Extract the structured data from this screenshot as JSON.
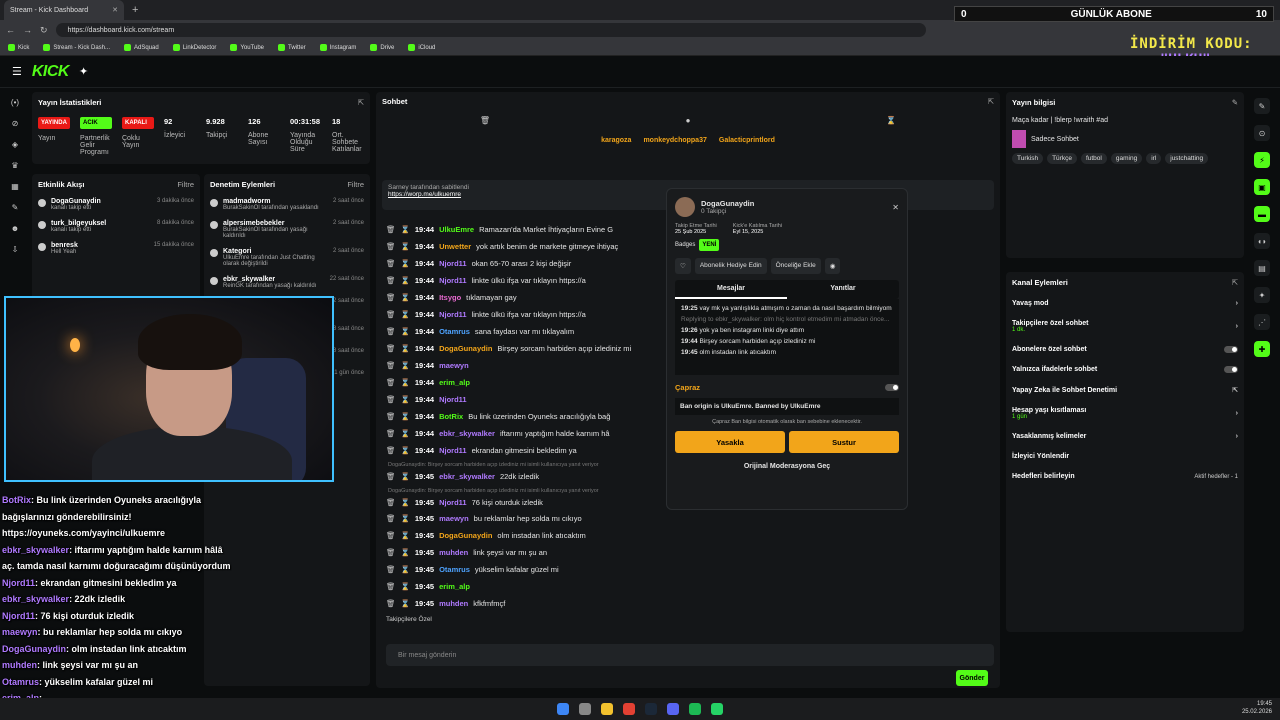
{
  "browser": {
    "tab_title": "Stream - Kick Dashboard",
    "url": "https://dashboard.kick.com/stream",
    "bookmarks": [
      "Kick",
      "Stream - Kick Dash...",
      "AdSquad",
      "LinkDetector",
      "YouTube",
      "Twitter",
      "Instagram",
      "Drive",
      "iCloud"
    ]
  },
  "overlay_top": {
    "count": "0",
    "label": "GÜNLÜK ABONE",
    "goal": "10",
    "promo1": "İNDİRİM KODU:",
    "promo2": "\"ULKU\""
  },
  "brand": {
    "logo": "KICK",
    "accent": "#53fc18"
  },
  "stats": {
    "title": "Yayın İstatistikleri",
    "items": [
      {
        "value": "YAYINDA",
        "label": "Yayın"
      },
      {
        "value": "ACIK",
        "label": "Partnerlik Gelir Programı"
      },
      {
        "value": "KAPALI",
        "label": "Çoklu Yayın"
      },
      {
        "value": "92",
        "label": "İzleyici"
      },
      {
        "value": "9.928",
        "label": "Takipçi"
      },
      {
        "value": "126",
        "label": "Abone Sayısı"
      },
      {
        "value": "00:31:58",
        "label": "Yayında Olduğu Süre"
      },
      {
        "value": "18",
        "label": "Ort. Sohbete Katılanlar"
      }
    ]
  },
  "activity": {
    "title": "Etkinlik Akışı",
    "filter": "Filtre",
    "items": [
      {
        "name": "DogaGunaydin",
        "sub": "kanalı takip etti",
        "time": "3 dakika önce"
      },
      {
        "name": "turk_bilgeyuksel",
        "sub": "kanalı takip etti",
        "time": "8 dakika önce"
      },
      {
        "name": "benresk",
        "sub": "Hell Yeah",
        "time": "15 dakika önce"
      }
    ]
  },
  "moderation": {
    "title": "Denetim Eylemleri",
    "filter": "Filtre",
    "items": [
      {
        "name": "madmadworm",
        "sub": "BurakSakinOl tarafından yasaklandı",
        "time": "2 saat önce"
      },
      {
        "name": "alpersimebebekler",
        "sub": "BurakSakinOl tarafından yasağı kaldırıldı",
        "time": "2 saat önce"
      },
      {
        "name": "Kategori",
        "sub": "UlkuEmre tarafından Just Chatting olarak değiştirildi",
        "time": "2 saat önce"
      },
      {
        "name": "ebkr_skywalker",
        "sub": "ReinGK tarafından yasağı kaldırıldı",
        "time": "22 saat önce"
      },
      {
        "name": "ebkr_skywalker",
        "sub": "ReinGK tarafından 5 dakika süreliğine sohbetten uzaklaştırıldı",
        "time": "22 saat önce"
      },
      {
        "name": "Mesaj Sabitlendi",
        "sub": "Sarney tarafından",
        "time": "18 saat önce"
      },
      {
        "name": "Mesaj Sabitlendi",
        "sub": "ReinGK tarafından",
        "time": "18 saat önce"
      },
      {
        "name": "PR_Yair",
        "sub": "MeyhaneciDimitri tarafından yasaklandı",
        "time": "1 gün önce"
      }
    ]
  },
  "chat": {
    "title": "Sohbet",
    "top_users": [
      {
        "name": "karagoza",
        "count": ""
      },
      {
        "name": "monkeydchoppa37",
        "count": "2"
      },
      {
        "name": "Galacticprintlord",
        "count": "1"
      }
    ],
    "pinned_by": "Sarney tarafından sabitlendi",
    "pinned_link": "https://worp.me/ulkuemre",
    "messages": [
      {
        "time": "19:44",
        "user": "UlkuEmre",
        "color": "#53fc18",
        "text": "Ramazan'da Market İhtiyaçların Evine G"
      },
      {
        "time": "19:44",
        "user": "Unwetter",
        "color": "#f2a51a",
        "text": "yok artık benim de markete gitmeye ihtiyaç"
      },
      {
        "time": "19:44",
        "user": "Njord11",
        "color": "#b07aff",
        "text": "okan 65-70 arası 2 kişi değişir"
      },
      {
        "time": "19:44",
        "user": "Njord11",
        "color": "#b07aff",
        "text": "linkte ülkü ifşa var tıklayın https://a"
      },
      {
        "time": "19:44",
        "user": "Itsygo",
        "color": "#e86ad1",
        "text": "tıklamayan gay"
      },
      {
        "time": "19:44",
        "user": "Njord11",
        "color": "#b07aff",
        "text": "linkte ülkü ifşa var tıklayın https://a"
      },
      {
        "time": "19:44",
        "user": "Otamrus",
        "color": "#4ea3ff",
        "text": "sana faydası var mı tıklayalım"
      },
      {
        "time": "19:44",
        "user": "DogaGunaydin",
        "color": "#f2a51a",
        "text": "Birşey sorcam harbiden açıp izlediniz mi"
      },
      {
        "time": "19:44",
        "user": "maewyn",
        "color": "#b07aff",
        "text": ""
      },
      {
        "time": "19:44",
        "user": "erim_alp",
        "color": "#53fc18",
        "text": ""
      },
      {
        "time": "19:44",
        "user": "Njord11",
        "color": "#b07aff",
        "text": ""
      },
      {
        "time": "19:44",
        "user": "BotRix",
        "color": "#53fc18",
        "text": "Bu link üzerinden Oyuneks aracılığıyla bağ"
      },
      {
        "time": "19:44",
        "user": "ebkr_skywalker",
        "color": "#b07aff",
        "text": "iftarımı yaptığım halde karnım hâ"
      },
      {
        "time": "19:44",
        "user": "Njord11",
        "color": "#b07aff",
        "text": "ekrandan gitmesini bekledim ya"
      },
      {
        "time": "19:45",
        "user": "ebkr_skywalker",
        "color": "#b07aff",
        "text": "22dk izledik"
      },
      {
        "time": "19:45",
        "user": "Njord11",
        "color": "#b07aff",
        "text": "76 kişi oturduk izledik"
      },
      {
        "time": "19:45",
        "user": "maewyn",
        "color": "#b07aff",
        "text": "bu reklamlar hep solda mı cıkıyo"
      },
      {
        "time": "19:45",
        "user": "DogaGunaydin",
        "color": "#f2a51a",
        "text": "olm instadan link atıcaktım"
      },
      {
        "time": "19:45",
        "user": "muhden",
        "color": "#b07aff",
        "text": "link şeysi var mı şu an"
      },
      {
        "time": "19:45",
        "user": "Otamrus",
        "color": "#4ea3ff",
        "text": "yükselim kafalar güzel mi"
      },
      {
        "time": "19:45",
        "user": "erim_alp",
        "color": "#53fc18",
        "text": ""
      },
      {
        "time": "19:45",
        "user": "muhden",
        "color": "#b07aff",
        "text": "kfkfmfmçf"
      }
    ],
    "reply1": "DogaGunaydin: Birşey sorcam harbiden açıp izlediniz mi isimli kullanıcıya yanıt veriyor",
    "reply2": "DogaGunaydin: Birşey sorcam harbiden açıp izlediniz mi isimli kullanıcıya yanıt veriyor",
    "followers_only": "Takipçilere Özel",
    "input_placeholder": "Bir mesaj gönderin",
    "send": "Gönder"
  },
  "usercard": {
    "name": "DogaGunaydin",
    "followers": "0 Takipçi",
    "follow_date_label": "Takip Etme Tarihi",
    "follow_date": "25 Şub 2025",
    "join_label": "Kick'e Katılma Tarihi",
    "join_date": "Eyl 15, 2025",
    "badges_label": "Badges",
    "new_badge": "YENİ",
    "gift_btn": "Abonelik Hediye Edin",
    "vip_btn": "Önceliğe Ekle",
    "tab_messages": "Mesajlar",
    "tab_replies": "Yanıtlar",
    "messages": [
      {
        "time": "19:25",
        "text": "vay mk ya yanlışlıkla atmışım o zaman da nasıl başardım bilmiyom"
      },
      {
        "time": "",
        "text": "Replying to ebkr_skywalker: olm hiç kontrol etmedim mi atmadan önce..."
      },
      {
        "time": "19:26",
        "text": "yok ya ben instagram linki diye attım"
      },
      {
        "time": "19:44",
        "text": "Birşey sorcam harbiden açıp izlediniz mi"
      },
      {
        "time": "19:45",
        "text": "olm instadan link atıcaktım"
      }
    ],
    "caprazlabel": "Çapraz",
    "ban_origin": "Ban origin is UlkuEmre. Banned by UlkuEmre",
    "ban_note": "Çapraz Ban bilgisi otomatik olarak ban sebebine eklenecektir.",
    "ban_btn": "Yasakla",
    "mute_btn": "Sustur",
    "original_mod": "Orijinal Moderasyona Geç"
  },
  "stream_info": {
    "title": "Yayın bilgisi",
    "stream_title": "Maça kadar | !blerp !wraith #ad",
    "category": "Sadece Sohbet",
    "tags": [
      "Turkish",
      "Türkçe",
      "futbol",
      "gaming",
      "irl",
      "justchatting"
    ]
  },
  "channel_actions": {
    "title": "Kanal Eylemleri",
    "items": [
      {
        "label": "Yavaş mod",
        "sub": "",
        "ctl": "arrow"
      },
      {
        "label": "Takipçilere özel sohbet",
        "sub": "1 dk.",
        "ctl": "arrow"
      },
      {
        "label": "Abonelere özel sohbet",
        "sub": "",
        "ctl": "toggle"
      },
      {
        "label": "Yalnızca ifadelerle sohbet",
        "sub": "",
        "ctl": "toggle"
      },
      {
        "label": "Yapay Zeka ile Sohbet Denetimi",
        "sub": "",
        "ctl": "ext"
      },
      {
        "label": "Hesap yaşı kısıtlaması",
        "sub": "1 gün",
        "ctl": "arrow"
      },
      {
        "label": "Yasaklanmış kelimeler",
        "sub": "",
        "ctl": "arrow"
      },
      {
        "label": "İzleyici Yönlendir",
        "sub": "",
        "ctl": ""
      },
      {
        "label": "Hedefleri belirleyin",
        "sub": "",
        "ctl": "goal"
      }
    ],
    "goal_text": "Aktif hedefler - 1"
  },
  "overlay_chat": [
    {
      "user": "BotRix",
      "text": ": Bu link üzerinden Oyuneks aracılığıyla bağışlarınızı gönderebilirsiniz! https://oyuneks.com/yayinci/ulkuemre"
    },
    {
      "user": "ebkr_skywalker",
      "text": ": iftarımı yaptığım halde karnım hâlâ aç. tamda nasıl karnımı doğuracağımı düşünüyordum"
    },
    {
      "user": "Njord11",
      "text": ": ekrandan gitmesini bekledim ya"
    },
    {
      "user": "ebkr_skywalker",
      "text": ": 22dk izledik"
    },
    {
      "user": "Njord11",
      "text": ": 76 kişi oturduk izledik"
    },
    {
      "user": "maewyn",
      "text": ": bu reklamlar hep solda mı cıkıyo"
    },
    {
      "user": "DogaGunaydin",
      "text": ": olm instadan link atıcaktım"
    },
    {
      "user": "muhden",
      "text": ": link şeysi var mı şu an"
    },
    {
      "user": "Otamrus",
      "text": ": yükselim kafalar güzel mi"
    },
    {
      "user": "erim_alp",
      "text": ":"
    },
    {
      "user": "muhden",
      "text": ": kfkfmfmçf"
    }
  ],
  "taskbar": {
    "time": "19:45",
    "date": "25.02.2026"
  }
}
